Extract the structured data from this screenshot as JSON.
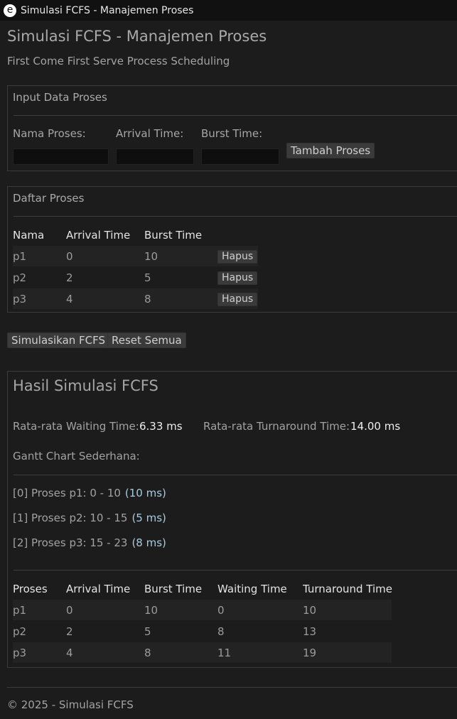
{
  "window": {
    "title": "Simulasi FCFS - Manajemen Proses",
    "icon": "e"
  },
  "header": {
    "title": "Simulasi FCFS - Manajemen Proses",
    "subtitle": "First Come First Serve Process Scheduling"
  },
  "input_section": {
    "title": "Input Data Proses",
    "name_label": "Nama Proses:",
    "arrival_label": "Arrival Time:",
    "burst_label": "Burst Time:",
    "name_value": "",
    "arrival_value": "",
    "burst_value": "",
    "add_button": "Tambah Proses"
  },
  "process_list": {
    "title": "Daftar Proses",
    "headers": [
      "Nama",
      "Arrival Time",
      "Burst Time"
    ],
    "rows": [
      {
        "name": "p1",
        "arrival": "0",
        "burst": "10",
        "delete": "Hapus"
      },
      {
        "name": "p2",
        "arrival": "2",
        "burst": "5",
        "delete": "Hapus"
      },
      {
        "name": "p3",
        "arrival": "4",
        "burst": "8",
        "delete": "Hapus"
      }
    ]
  },
  "actions": {
    "simulate": "Simulasikan FCFS",
    "reset": "Reset Semua"
  },
  "results": {
    "title": "Hasil Simulasi FCFS",
    "avg_waiting_label": "Rata-rata Waiting Time:",
    "avg_waiting_value": "6.33 ms",
    "avg_turnaround_label": "Rata-rata Turnaround Time:",
    "avg_turnaround_value": "14.00 ms",
    "gantt_label": "Gantt Chart Sederhana:",
    "gantt": [
      {
        "text": "[0] Proses p1: 0 - 10",
        "duration": "(10 ms)"
      },
      {
        "text": "[1] Proses p2: 10 - 15",
        "duration": "(5 ms)"
      },
      {
        "text": "[2] Proses p3: 15 - 23",
        "duration": "(8 ms)"
      }
    ],
    "table_headers": [
      "Proses",
      "Arrival Time",
      "Burst Time",
      "Waiting Time",
      "Turnaround Time"
    ],
    "table_rows": [
      [
        "p1",
        "0",
        "10",
        "0",
        "10"
      ],
      [
        "p2",
        "2",
        "5",
        "8",
        "13"
      ],
      [
        "p3",
        "4",
        "8",
        "11",
        "19"
      ]
    ]
  },
  "footer": {
    "text": "© 2025 - Simulasi FCFS"
  },
  "colors": {
    "background": "#1c1c1c",
    "titlebar": "#111111",
    "input_bg": "#0e0e0e",
    "button_bg": "#3a3a3a",
    "row_stripe": "#232323",
    "duration_accent": "#a9cbe0"
  }
}
